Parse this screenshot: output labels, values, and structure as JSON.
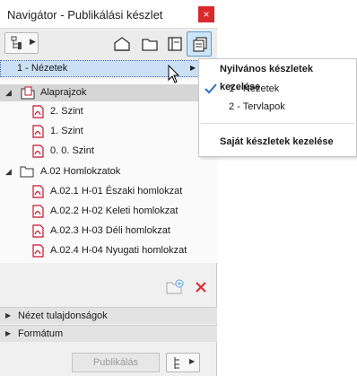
{
  "window": {
    "title": "Navigátor - Publikálási készlet",
    "close_glyph": "×"
  },
  "toolbar": {
    "icons": [
      "navigator-tree-icon",
      "project-map-icon",
      "view-map-icon",
      "layout-book-icon",
      "publisher-sets-icon"
    ]
  },
  "view_set": {
    "label": "1 - Nézetek"
  },
  "tree": {
    "folders": [
      {
        "label": "Alaprajzok",
        "items": [
          "2. Szint",
          "1. Szint",
          "0. 0. Szint"
        ]
      },
      {
        "label": "A.02 Homlokzatok",
        "items": [
          "A.02.1 H-01 Északi homlokzat",
          "A.02.2 H-02 Keleti homlokzat",
          "A.02.3 H-03 Déli homlokzat",
          "A.02.4 H-04 Nyugati homlokzat"
        ]
      }
    ]
  },
  "sections": {
    "view_properties": "Nézet tulajdonságok",
    "format": "Formátum"
  },
  "bottom": {
    "publish_label": "Publikálás"
  },
  "menu": {
    "header": "Nyilvános készletek kezelése",
    "items": [
      "1 - Nézetek",
      "2 - Tervlapok"
    ],
    "checked_index": 0,
    "footer": "Saját készletek kezelése"
  },
  "colors": {
    "accent": "#5b9bd5",
    "close": "#d9292b",
    "delete": "#d9292b",
    "pdf_red": "#c8102e",
    "selection": "#cbe0f5"
  }
}
